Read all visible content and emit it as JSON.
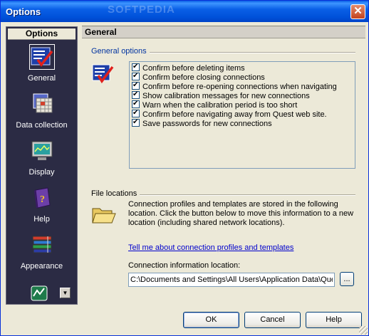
{
  "window": {
    "title": "Options",
    "watermark": "SOFTPEDIA"
  },
  "nav": {
    "header": "Options",
    "items": [
      {
        "label": "General",
        "icon": "checklist-icon",
        "selected": true
      },
      {
        "label": "Data collection",
        "icon": "data-grid-icon"
      },
      {
        "label": "Display",
        "icon": "monitor-icon"
      },
      {
        "label": "Help",
        "icon": "help-book-icon"
      },
      {
        "label": "Appearance",
        "icon": "stacked-books-icon"
      }
    ]
  },
  "panel": {
    "title": "General",
    "general_options": {
      "label": "General options",
      "items": [
        {
          "label": "Confirm before deleting items",
          "checked": true
        },
        {
          "label": "Confirm before closing connections",
          "checked": true
        },
        {
          "label": "Confirm before re-opening connections when navigating",
          "checked": true
        },
        {
          "label": "Show calibration messages for new connections",
          "checked": true
        },
        {
          "label": "Warn when the calibration period is too short",
          "checked": true
        },
        {
          "label": "Confirm before navigating away from Quest web site.",
          "checked": true
        },
        {
          "label": "Save passwords for new connections",
          "checked": true
        }
      ]
    },
    "file_locations": {
      "label": "File locations",
      "description": "Connection profiles and templates are stored in the following location.  Click the button below to move this information to a new location (including shared network locations).",
      "link": "Tell me about connection profiles and templates",
      "location_label": "Connection information location:",
      "location_value": "C:\\Documents and Settings\\All Users\\Application Data\\Quest",
      "browse_label": "..."
    }
  },
  "buttons": {
    "ok": "OK",
    "cancel": "Cancel",
    "help": "Help"
  },
  "colors": {
    "title_bar": "#0a5fe6",
    "nav_bg": "#2b2b44",
    "link": "#0000cc",
    "group_label": "#0033a0"
  }
}
